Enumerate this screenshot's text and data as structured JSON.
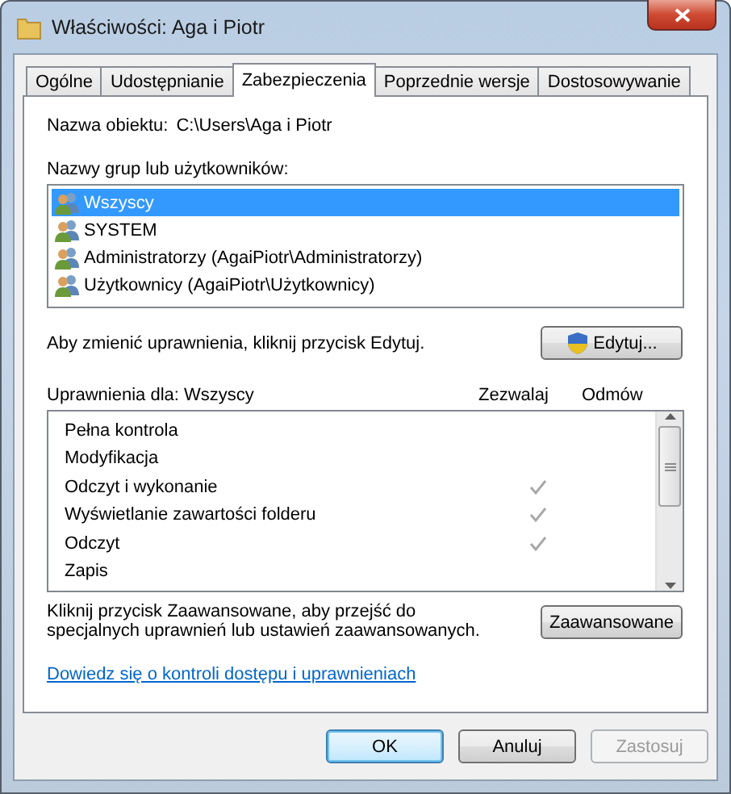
{
  "window": {
    "title": "Właściwości: Aga i Piotr"
  },
  "tabs": [
    {
      "label": "Ogólne",
      "selected": false
    },
    {
      "label": "Udostępnianie",
      "selected": false
    },
    {
      "label": "Zabezpieczenia",
      "selected": true
    },
    {
      "label": "Poprzednie wersje",
      "selected": false
    },
    {
      "label": "Dostosowywanie",
      "selected": false
    }
  ],
  "object_name": {
    "label": "Nazwa obiektu:",
    "value": "C:\\Users\\Aga i Piotr"
  },
  "groups": {
    "label": "Nazwy grup lub użytkowników:",
    "items": [
      {
        "name": "Wszyscy",
        "selected": true
      },
      {
        "name": "SYSTEM",
        "selected": false
      },
      {
        "name": "Administratorzy (AgaiPiotr\\Administratorzy)",
        "selected": false
      },
      {
        "name": "Użytkownicy (AgaiPiotr\\Użytkownicy)",
        "selected": false
      }
    ]
  },
  "edit_hint": "Aby zmienić uprawnienia, kliknij przycisk Edytuj.",
  "edit_button": "Edytuj...",
  "permissions": {
    "label": "Uprawnienia dla: Wszyscy",
    "allow_header": "Zezwalaj",
    "deny_header": "Odmów",
    "rows": [
      {
        "name": "Pełna kontrola",
        "allow": false
      },
      {
        "name": "Modyfikacja",
        "allow": false
      },
      {
        "name": "Odczyt i wykonanie",
        "allow": true
      },
      {
        "name": "Wyświetlanie zawartości folderu",
        "allow": true
      },
      {
        "name": "Odczyt",
        "allow": true
      },
      {
        "name": "Zapis",
        "allow": false
      }
    ]
  },
  "advanced_hint": "Kliknij przycisk Zaawansowane, aby przejść do specjalnych uprawnień lub ustawień zaawansowanych.",
  "advanced_button": "Zaawansowane",
  "help_link": "Dowiedz się o kontroli dostępu i uprawnieniach",
  "buttons": [
    {
      "label": "OK",
      "default": true,
      "disabled": false
    },
    {
      "label": "Anuluj",
      "default": false,
      "disabled": false
    },
    {
      "label": "Zastosuj",
      "default": false,
      "disabled": true
    }
  ]
}
